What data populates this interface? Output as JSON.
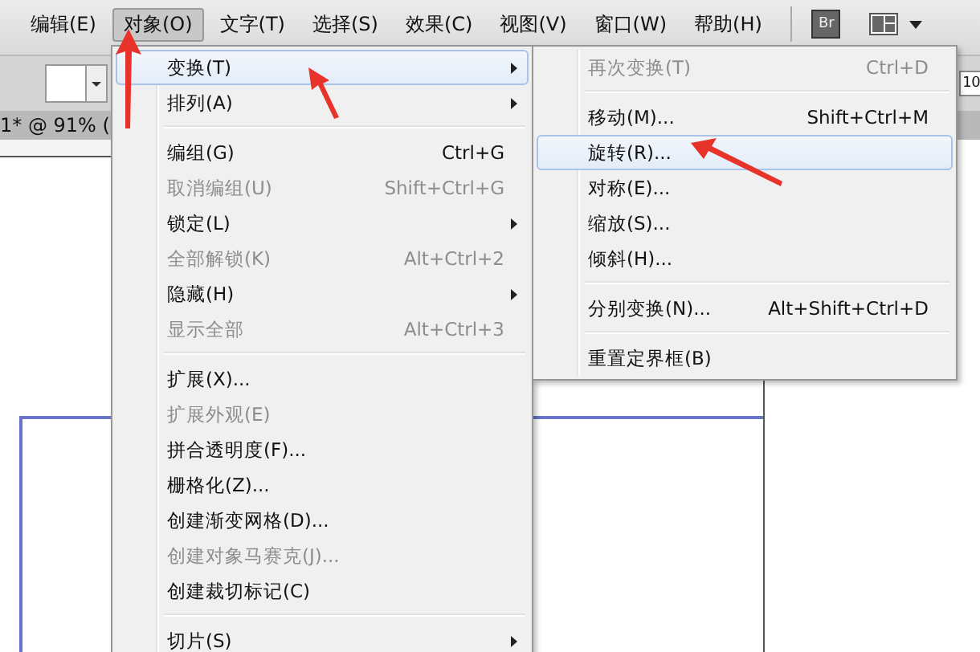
{
  "menubar": [
    {
      "label": "编辑(E)",
      "selected": false
    },
    {
      "label": "对象(O)",
      "selected": true
    },
    {
      "label": "文字(T)",
      "selected": false
    },
    {
      "label": "选择(S)",
      "selected": false
    },
    {
      "label": "效果(C)",
      "selected": false
    },
    {
      "label": "视图(V)",
      "selected": false
    },
    {
      "label": "窗口(W)",
      "selected": false
    },
    {
      "label": "帮助(H)",
      "selected": false
    }
  ],
  "bridge_button": {
    "label": "Br"
  },
  "zoom_field": {
    "value": "10"
  },
  "document_tab": {
    "title": "1* @ 91% ("
  },
  "menu": [
    {
      "kind": "item",
      "label": "变换(T)",
      "submenu": true,
      "disabled": false,
      "selected": true
    },
    {
      "kind": "item",
      "label": "排列(A)",
      "submenu": true,
      "disabled": false,
      "selected": false
    },
    {
      "kind": "separator"
    },
    {
      "kind": "item",
      "label": "编组(G)",
      "shortcut": "Ctrl+G",
      "disabled": false,
      "selected": false
    },
    {
      "kind": "item",
      "label": "取消编组(U)",
      "shortcut": "Shift+Ctrl+G",
      "disabled": true,
      "selected": false
    },
    {
      "kind": "item",
      "label": "锁定(L)",
      "submenu": true,
      "disabled": false,
      "selected": false
    },
    {
      "kind": "item",
      "label": "全部解锁(K)",
      "shortcut": "Alt+Ctrl+2",
      "disabled": true,
      "selected": false
    },
    {
      "kind": "item",
      "label": "隐藏(H)",
      "submenu": true,
      "disabled": false,
      "selected": false
    },
    {
      "kind": "item",
      "label": "显示全部",
      "shortcut": "Alt+Ctrl+3",
      "disabled": true,
      "selected": false
    },
    {
      "kind": "separator"
    },
    {
      "kind": "item",
      "label": "扩展(X)...",
      "disabled": false,
      "selected": false
    },
    {
      "kind": "item",
      "label": "扩展外观(E)",
      "disabled": true,
      "selected": false
    },
    {
      "kind": "item",
      "label": "拼合透明度(F)...",
      "disabled": false,
      "selected": false
    },
    {
      "kind": "item",
      "label": "栅格化(Z)...",
      "disabled": false,
      "selected": false
    },
    {
      "kind": "item",
      "label": "创建渐变网格(D)...",
      "disabled": false,
      "selected": false
    },
    {
      "kind": "item",
      "label": "创建对象马赛克(J)...",
      "disabled": true,
      "selected": false
    },
    {
      "kind": "item",
      "label": "创建裁切标记(C)",
      "disabled": false,
      "selected": false
    },
    {
      "kind": "separator"
    },
    {
      "kind": "item",
      "label": "切片(S)",
      "submenu": true,
      "disabled": false,
      "selected": false
    }
  ],
  "submenu": [
    {
      "kind": "item",
      "label": "再次变换(T)",
      "shortcut": "Ctrl+D",
      "disabled": true,
      "selected": false
    },
    {
      "kind": "separator"
    },
    {
      "kind": "item",
      "label": "移动(M)...",
      "shortcut": "Shift+Ctrl+M",
      "disabled": false,
      "selected": false
    },
    {
      "kind": "item",
      "label": "旋转(R)...",
      "disabled": false,
      "selected": true
    },
    {
      "kind": "item",
      "label": "对称(E)...",
      "disabled": false,
      "selected": false
    },
    {
      "kind": "item",
      "label": "缩放(S)...",
      "disabled": false,
      "selected": false
    },
    {
      "kind": "item",
      "label": "倾斜(H)...",
      "disabled": false,
      "selected": false
    },
    {
      "kind": "separator"
    },
    {
      "kind": "item",
      "label": "分别变换(N)...",
      "shortcut": "Alt+Shift+Ctrl+D",
      "disabled": false,
      "selected": false
    },
    {
      "kind": "separator"
    },
    {
      "kind": "item",
      "label": "重置定界框(B)",
      "disabled": false,
      "selected": false
    }
  ]
}
